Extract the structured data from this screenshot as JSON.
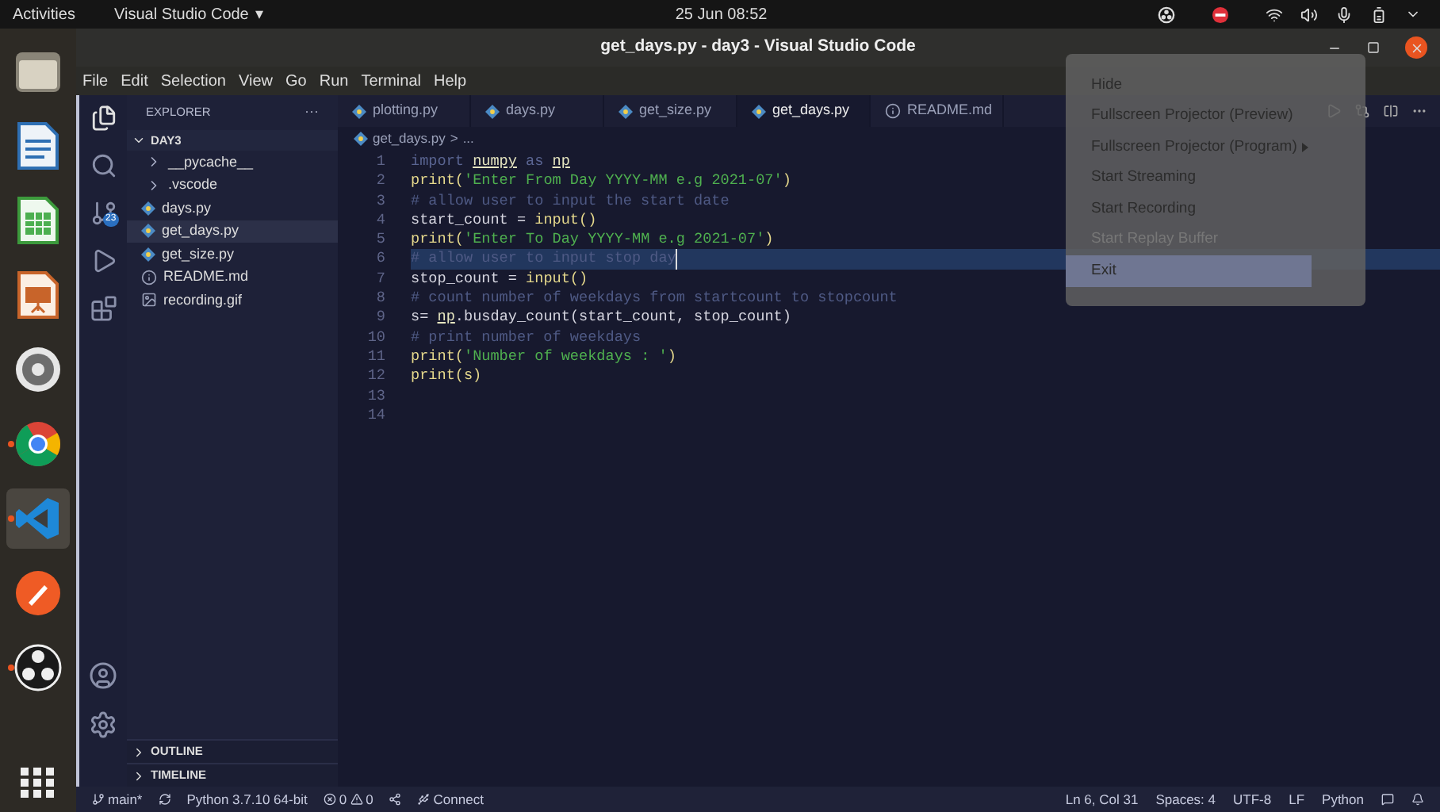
{
  "top_bar": {
    "activities": "Activities",
    "app_menu": "Visual Studio Code",
    "app_menu_caret": "▾",
    "clock": "25 Jun  08:52"
  },
  "dock": [
    {
      "kind": "files",
      "running": false,
      "selected": false
    },
    {
      "kind": "writer",
      "running": false,
      "selected": false
    },
    {
      "kind": "calc",
      "running": false,
      "selected": false
    },
    {
      "kind": "impress",
      "running": false,
      "selected": false
    },
    {
      "kind": "settings",
      "running": false,
      "selected": false
    },
    {
      "kind": "chrome",
      "running": true,
      "selected": false
    },
    {
      "kind": "vscode",
      "running": true,
      "selected": true
    },
    {
      "kind": "postman",
      "running": false,
      "selected": false
    },
    {
      "kind": "obs",
      "running": true,
      "selected": false
    }
  ],
  "window": {
    "title": "get_days.py - day3 - Visual Studio Code"
  },
  "menu_bar": [
    "File",
    "Edit",
    "Selection",
    "View",
    "Go",
    "Run",
    "Terminal",
    "Help"
  ],
  "activity_bar": {
    "source_control_badge": "23"
  },
  "sidebar": {
    "header": "EXPLORER",
    "more": "···",
    "folder": "DAY3",
    "items": [
      {
        "kind": "folder",
        "label": "__pycache__",
        "selected": false
      },
      {
        "kind": "folder",
        "label": ".vscode",
        "selected": false
      },
      {
        "kind": "python",
        "label": "days.py",
        "selected": false
      },
      {
        "kind": "python",
        "label": "get_days.py",
        "selected": true
      },
      {
        "kind": "python",
        "label": "get_size.py",
        "selected": false
      },
      {
        "kind": "info",
        "label": "README.md",
        "selected": false
      },
      {
        "kind": "image",
        "label": "recording.gif",
        "selected": false
      }
    ],
    "sections": [
      "OUTLINE",
      "TIMELINE"
    ]
  },
  "tabs": [
    {
      "kind": "python",
      "label": "plotting.py",
      "selected": false
    },
    {
      "kind": "python",
      "label": "days.py",
      "selected": false
    },
    {
      "kind": "python",
      "label": "get_size.py",
      "selected": false
    },
    {
      "kind": "python",
      "label": "get_days.py",
      "selected": true
    },
    {
      "kind": "info",
      "label": "README.md",
      "selected": false
    }
  ],
  "breadcrumb": [
    "get_days.py",
    ">",
    "..."
  ],
  "code": [
    {
      "number": "1",
      "selected": false,
      "tokens": [
        {
          "kind": "keyword",
          "text": "import "
        },
        {
          "kind": "module",
          "text": "numpy"
        },
        {
          "kind": "keyword",
          "text": " as "
        },
        {
          "kind": "module",
          "text": "np"
        }
      ]
    },
    {
      "number": "2",
      "selected": false,
      "tokens": [
        {
          "kind": "func",
          "text": "print("
        },
        {
          "kind": "string",
          "text": "'Enter From Day YYYY-MM e.g 2021-07'"
        },
        {
          "kind": "func",
          "text": ")"
        }
      ]
    },
    {
      "number": "3",
      "selected": false,
      "tokens": [
        {
          "kind": "comment",
          "text": "# allow user to input the start date"
        }
      ]
    },
    {
      "number": "4",
      "selected": false,
      "tokens": [
        {
          "kind": "plain",
          "text": "start_count = "
        },
        {
          "kind": "func",
          "text": "input()"
        }
      ]
    },
    {
      "number": "5",
      "selected": false,
      "tokens": [
        {
          "kind": "func",
          "text": "print("
        },
        {
          "kind": "string",
          "text": "'Enter To Day YYYY-MM e.g 2021-07'"
        },
        {
          "kind": "func",
          "text": ")"
        }
      ]
    },
    {
      "number": "6",
      "selected": true,
      "tokens": [
        {
          "kind": "comment",
          "text": "# allow user to input stop day"
        }
      ]
    },
    {
      "number": "7",
      "selected": false,
      "tokens": [
        {
          "kind": "plain",
          "text": "stop_count = "
        },
        {
          "kind": "func",
          "text": "input()"
        }
      ]
    },
    {
      "number": "8",
      "selected": false,
      "tokens": [
        {
          "kind": "comment",
          "text": "# count number of weekdays from startcount to stopcount"
        }
      ]
    },
    {
      "number": "9",
      "selected": false,
      "tokens": [
        {
          "kind": "plain",
          "text": "s= "
        },
        {
          "kind": "module",
          "text": "np"
        },
        {
          "kind": "plain",
          "text": ".busday_count(start_count, stop_count)"
        }
      ]
    },
    {
      "number": "10",
      "selected": false,
      "tokens": [
        {
          "kind": "comment",
          "text": "# print number of weekdays"
        }
      ]
    },
    {
      "number": "11",
      "selected": false,
      "tokens": [
        {
          "kind": "func",
          "text": "print("
        },
        {
          "kind": "string",
          "text": "'Number of weekdays : '"
        },
        {
          "kind": "func",
          "text": ")"
        }
      ]
    },
    {
      "number": "12",
      "selected": false,
      "tokens": [
        {
          "kind": "func",
          "text": "print(s)"
        }
      ]
    },
    {
      "number": "13",
      "selected": false
    },
    {
      "number": "14",
      "selected": false
    }
  ],
  "tray_menu": [
    {
      "label": "Hide",
      "disabled": false,
      "selected": false,
      "submenu": false
    },
    {
      "label": "Fullscreen Projector (Preview)",
      "disabled": false,
      "selected": false,
      "submenu": false
    },
    {
      "label": "Fullscreen Projector (Program)",
      "disabled": false,
      "selected": false,
      "submenu": true
    },
    {
      "label": "Start Streaming",
      "disabled": false,
      "selected": false,
      "submenu": false
    },
    {
      "label": "Start Recording",
      "disabled": false,
      "selected": false,
      "submenu": false
    },
    {
      "label": "Start Replay Buffer",
      "disabled": true,
      "selected": false,
      "submenu": false
    },
    {
      "label": "Exit",
      "disabled": false,
      "selected": true,
      "submenu": false
    }
  ],
  "status_bar": {
    "branch": "main*",
    "interpreter": "Python 3.7.10 64-bit",
    "errors": "0",
    "warnings": "0",
    "connect": "Connect",
    "right": [
      "Ln 6, Col 31",
      "Spaces: 4",
      "UTF-8",
      "LF",
      "Python"
    ]
  }
}
